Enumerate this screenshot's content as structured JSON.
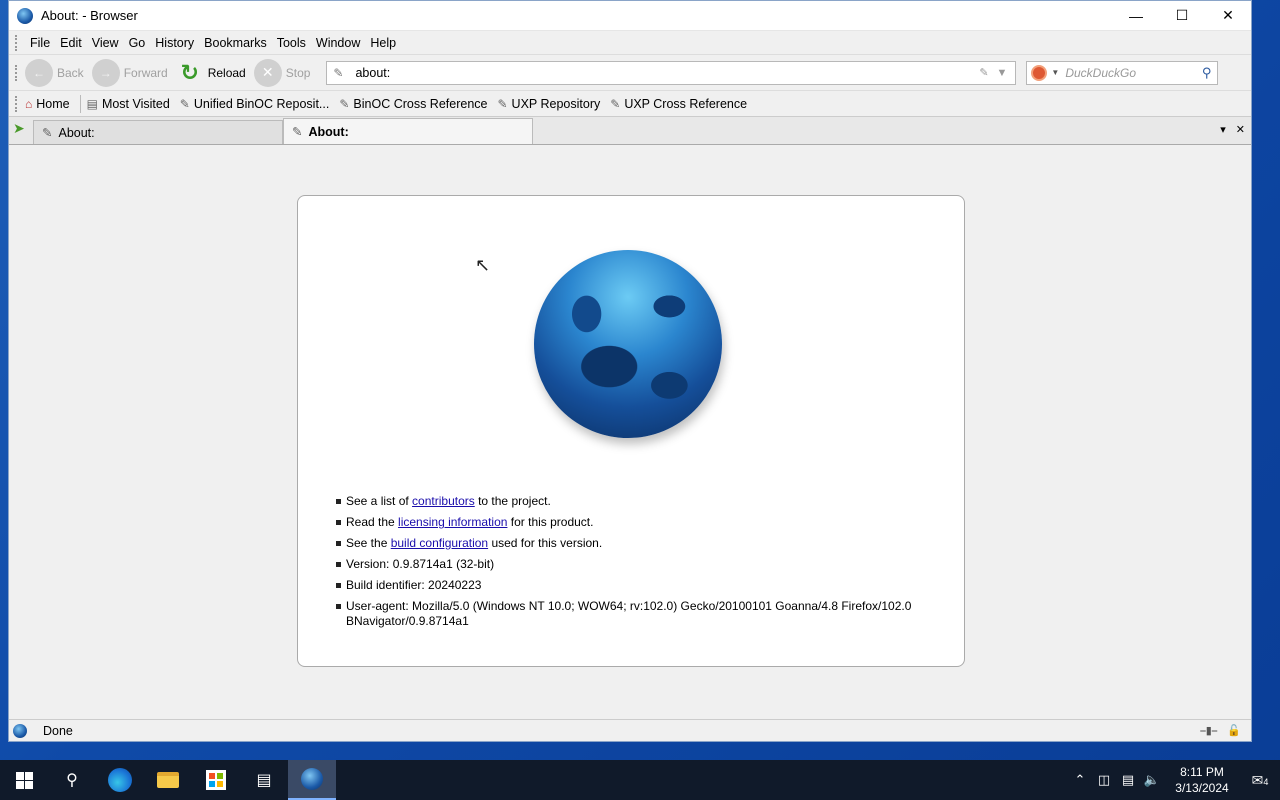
{
  "window": {
    "title": "About: - Browser",
    "controls": {
      "minimize": "—",
      "maximize": "☐",
      "close": "✕"
    }
  },
  "menu": [
    "File",
    "Edit",
    "View",
    "Go",
    "History",
    "Bookmarks",
    "Tools",
    "Window",
    "Help"
  ],
  "nav": {
    "back": "Back",
    "forward": "Forward",
    "reload": "Reload",
    "stop": "Stop",
    "url": "about:",
    "search_placeholder": "DuckDuckGo"
  },
  "bookmarks": [
    "Home",
    "Most Visited",
    "Unified BinOC Reposit...",
    "BinOC Cross Reference",
    "UXP Repository",
    "UXP Cross Reference"
  ],
  "tabs": [
    {
      "label": "About:",
      "active": false
    },
    {
      "label": "About:",
      "active": true
    }
  ],
  "about": {
    "line1_pre": "See a list of ",
    "line1_link": "contributors",
    "line1_post": " to the project.",
    "line2_pre": "Read the ",
    "line2_link": "licensing information",
    "line2_post": " for this product.",
    "line3_pre": "See the ",
    "line3_link": "build configuration",
    "line3_post": " used for this version.",
    "version": "Version: 0.9.8714a1 (32-bit)",
    "build": "Build identifier: 20240223",
    "useragent": "User-agent: Mozilla/5.0 (Windows NT 10.0; WOW64; rv:102.0) Gecko/20100101 Goanna/4.8 Firefox/102.0 BNavigator/0.9.8714a1"
  },
  "status": {
    "text": "Done"
  },
  "taskbar": {
    "time": "8:11 PM",
    "date": "3/13/2024",
    "notifications": "4"
  }
}
